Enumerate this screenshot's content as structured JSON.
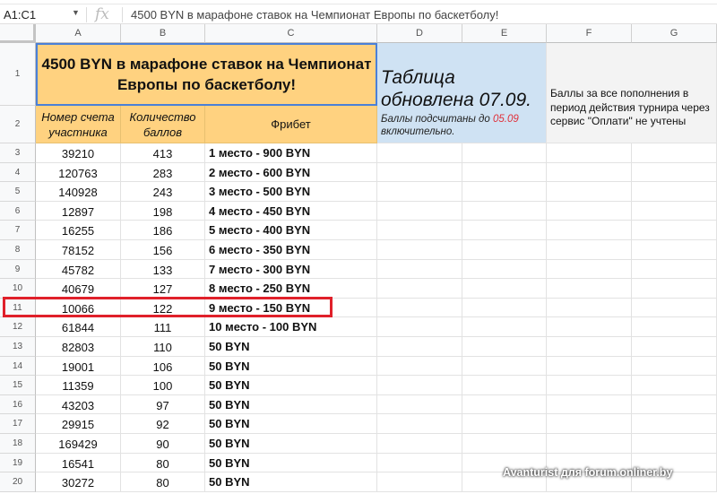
{
  "formula_bar": {
    "name_box": "A1:C1",
    "fx": "fx",
    "content": "4500 BYN в марафоне ставок на Чемпионат Европы по баскетболу!"
  },
  "columns": [
    "A",
    "B",
    "C",
    "D",
    "E",
    "F",
    "G"
  ],
  "title": "4500 BYN в марафоне ставок на Чемпионат Европы по баскетболу!",
  "headers": {
    "account": "Номер счета участника",
    "points": "Количество баллов",
    "freebet": "Фрибет"
  },
  "update": {
    "title": "Таблица обновлена 07.09.",
    "note_prefix": "Баллы подсчитаны до ",
    "note_date": "05.09",
    "note_suffix": " включительно."
  },
  "note_f": "Баллы за все пополнения в период действия турнира через сервис \"Оплати\" не учтены",
  "rows": [
    {
      "n": "3",
      "account": "39210",
      "points": "413",
      "prize": "1 место - 900 BYN"
    },
    {
      "n": "4",
      "account": "120763",
      "points": "283",
      "prize": "2 место - 600 BYN"
    },
    {
      "n": "5",
      "account": "140928",
      "points": "243",
      "prize": "3 место - 500 BYN"
    },
    {
      "n": "6",
      "account": "12897",
      "points": "198",
      "prize": "4 место - 450 BYN"
    },
    {
      "n": "7",
      "account": "16255",
      "points": "186",
      "prize": "5 место - 400 BYN"
    },
    {
      "n": "8",
      "account": "78152",
      "points": "156",
      "prize": "6 место - 350 BYN"
    },
    {
      "n": "9",
      "account": "45782",
      "points": "133",
      "prize": "7 место - 300 BYN"
    },
    {
      "n": "10",
      "account": "40679",
      "points": "127",
      "prize": "8 место - 250 BYN"
    },
    {
      "n": "11",
      "account": "10066",
      "points": "122",
      "prize": "9 место - 150 BYN"
    },
    {
      "n": "12",
      "account": "61844",
      "points": "111",
      "prize": "10 место - 100 BYN"
    },
    {
      "n": "13",
      "account": "82803",
      "points": "110",
      "prize": "50 BYN"
    },
    {
      "n": "14",
      "account": "19001",
      "points": "106",
      "prize": "50 BYN"
    },
    {
      "n": "15",
      "account": "11359",
      "points": "100",
      "prize": "50 BYN"
    },
    {
      "n": "16",
      "account": "43203",
      "points": "97",
      "prize": "50 BYN"
    },
    {
      "n": "17",
      "account": "29915",
      "points": "92",
      "prize": "50 BYN"
    },
    {
      "n": "18",
      "account": "169429",
      "points": "90",
      "prize": "50 BYN"
    },
    {
      "n": "19",
      "account": "16541",
      "points": "80",
      "prize": "50 BYN"
    },
    {
      "n": "20",
      "account": "30272",
      "points": "80",
      "prize": "50 BYN"
    }
  ],
  "row_labels": {
    "r1": "1",
    "r2": "2"
  },
  "highlight_row": "11",
  "watermark": "Avanturist для forum.onliner.by",
  "colors": {
    "orange": "#ffd280",
    "blue": "#cfe2f3",
    "highlight": "#e0202a",
    "red_date": "#e0303a"
  }
}
